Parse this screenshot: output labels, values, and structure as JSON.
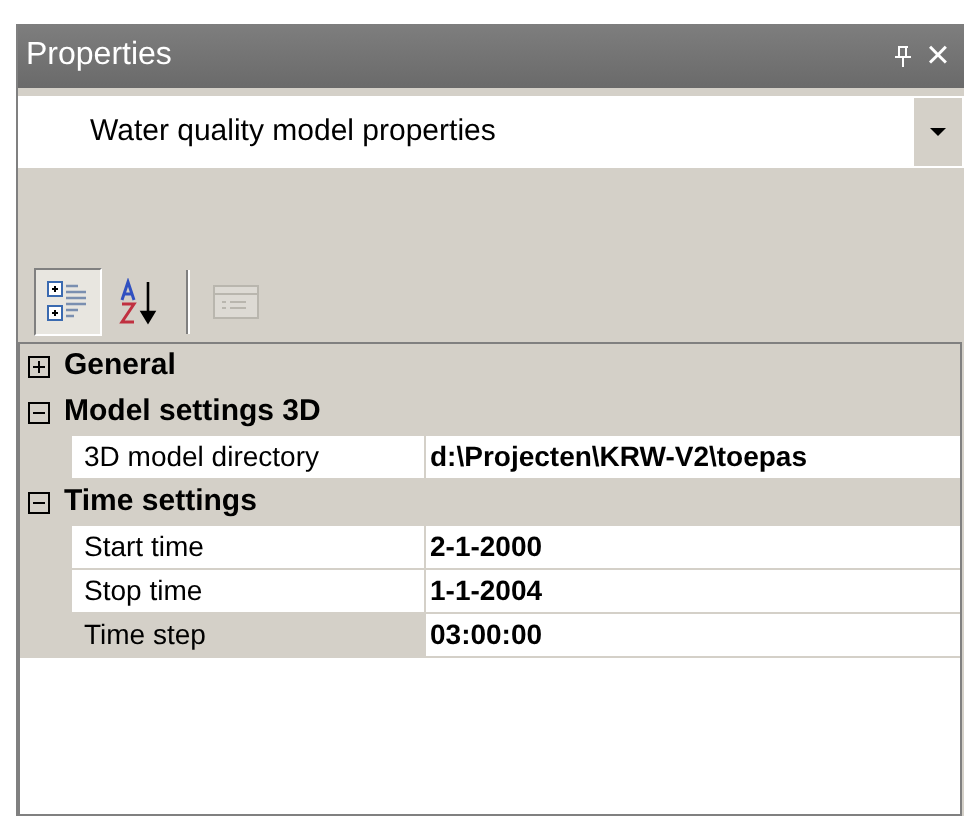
{
  "window": {
    "title": "Properties",
    "close": "×"
  },
  "object_selector": {
    "value": "Water quality model properties"
  },
  "toolbar": [
    {
      "kind": "categorized",
      "selected": true,
      "disabled": false
    },
    {
      "kind": "alphabetical",
      "selected": false,
      "disabled": false
    },
    {
      "kind": "separator"
    },
    {
      "kind": "pages",
      "selected": false,
      "disabled": true
    }
  ],
  "categories": [
    {
      "name": "General",
      "expanded": false
    },
    {
      "name": "Model settings 3D",
      "expanded": true,
      "properties": [
        {
          "name": "3D model directory",
          "value": "d:\\Projecten\\KRW-V2\\toepas",
          "selected": false
        }
      ]
    },
    {
      "name": "Time settings",
      "expanded": true,
      "properties": [
        {
          "name": "Start time",
          "value": "2-1-2000",
          "selected": false
        },
        {
          "name": "Stop time",
          "value": "1-1-2004",
          "selected": false
        },
        {
          "name": "Time step",
          "value": "03:00:00",
          "selected": true
        }
      ]
    }
  ]
}
